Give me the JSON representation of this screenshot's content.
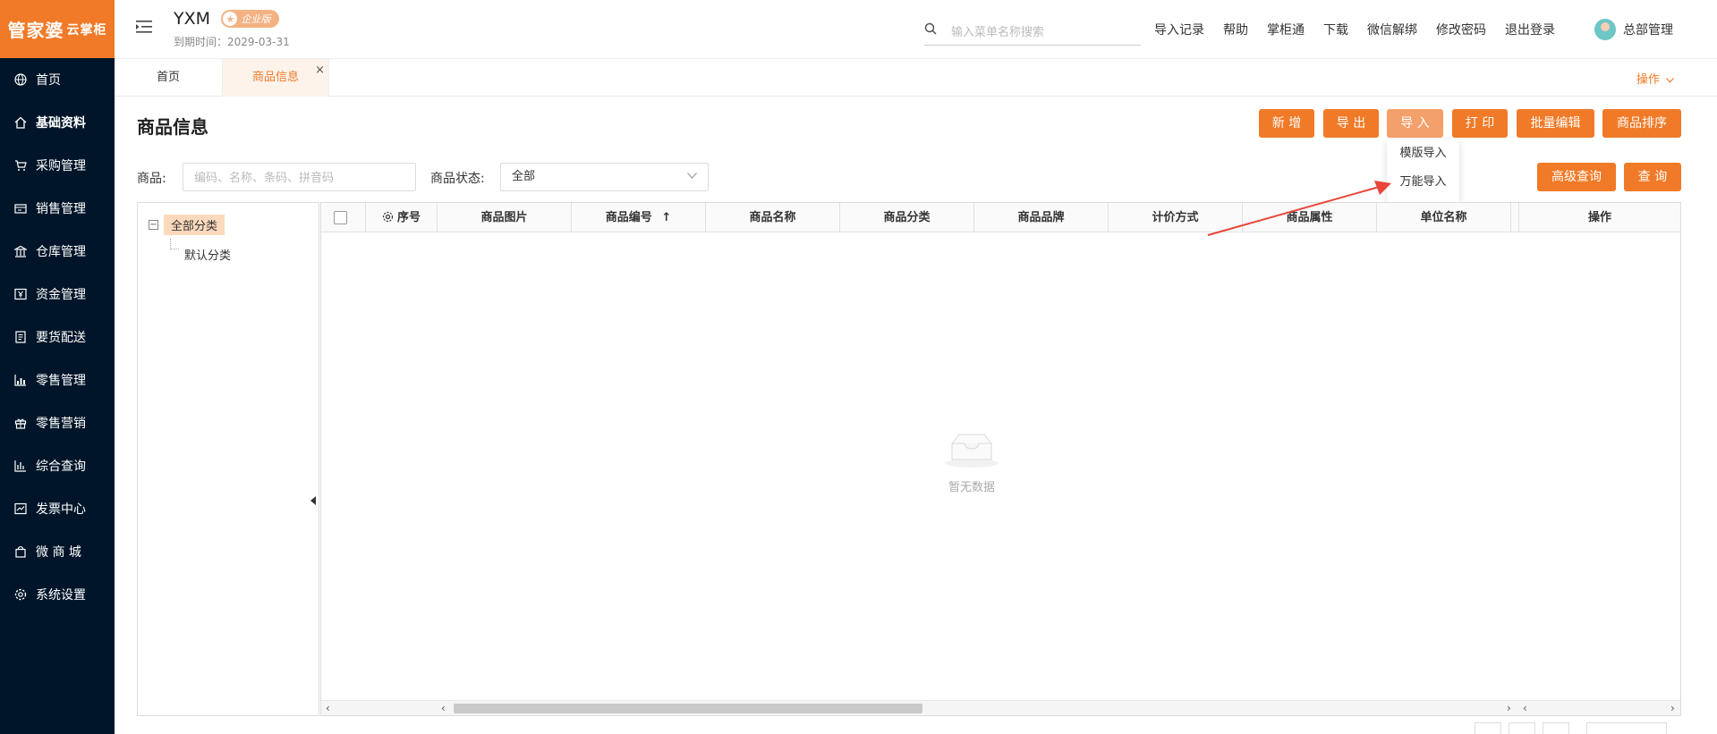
{
  "app": {
    "logo_main": "管家婆",
    "logo_sub": "云掌柜",
    "org_name": "YXM",
    "edition_badge": "企业版",
    "expire_text": "到期时间：2029-03-31"
  },
  "sidebar": {
    "items": [
      {
        "label": "首页",
        "icon": "globe-icon"
      },
      {
        "label": "基础资料",
        "icon": "home-icon",
        "active": true
      },
      {
        "label": "采购管理",
        "icon": "cart-icon"
      },
      {
        "label": "销售管理",
        "icon": "sales-icon"
      },
      {
        "label": "仓库管理",
        "icon": "warehouse-icon"
      },
      {
        "label": "资金管理",
        "icon": "money-icon"
      },
      {
        "label": "要货配送",
        "icon": "delivery-icon"
      },
      {
        "label": "零售管理",
        "icon": "retail-chart-icon"
      },
      {
        "label": "零售营销",
        "icon": "gift-icon"
      },
      {
        "label": "综合查询",
        "icon": "bar-chart-icon"
      },
      {
        "label": "发票中心",
        "icon": "invoice-icon"
      },
      {
        "label": "微 商 城",
        "icon": "shop-bag-icon"
      },
      {
        "label": "系统设置",
        "icon": "gear-icon"
      }
    ]
  },
  "header": {
    "search_placeholder": "输入菜单名称搜索",
    "links": [
      "导入记录",
      "帮助",
      "掌柜通",
      "下载",
      "微信解绑",
      "修改密码",
      "退出登录"
    ],
    "user_name": "总部管理"
  },
  "tabs": {
    "home": "首页",
    "goods": "商品信息",
    "close": "×",
    "operations": "操作"
  },
  "page": {
    "title": "商品信息",
    "buttons": {
      "add": "新 增",
      "export": "导 出",
      "import": "导 入",
      "print": "打 印",
      "batch_edit": "批量编辑",
      "sort": "商品排序",
      "advanced_query": "高级查询",
      "query": "查 询"
    },
    "import_menu": [
      "模版导入",
      "万能导入"
    ],
    "filters": {
      "goods_label": "商品:",
      "goods_placeholder": "编码、名称、条码、拼音码",
      "status_label": "商品状态:",
      "status_value": "全部"
    }
  },
  "tree": {
    "root": "全部分类",
    "toggle": "−",
    "children": [
      "默认分类"
    ]
  },
  "table": {
    "columns": [
      "序号",
      "商品图片",
      "商品编号",
      "商品名称",
      "商品分类",
      "商品品牌",
      "计价方式",
      "商品属性",
      "单位名称",
      "操作"
    ],
    "sort_indicator": "↑",
    "empty_text": "暂无数据"
  },
  "colors": {
    "accent": "#f07a28",
    "sidebar_bg": "#001529",
    "arrow": "#e8443a"
  }
}
